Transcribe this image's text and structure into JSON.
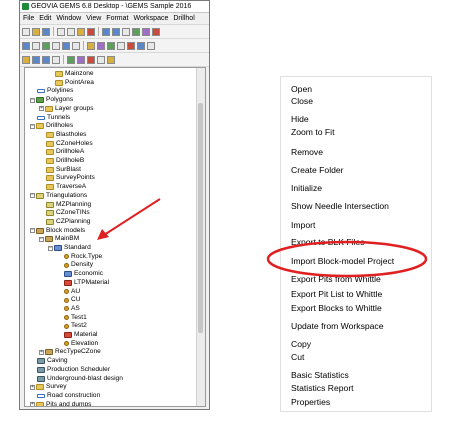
{
  "window": {
    "title": "GEOVIA GEMS 6.8 Desktop - \\GEMS Sample 2016"
  },
  "menubar": [
    "File",
    "Edit",
    "Window",
    "View",
    "Format",
    "Workspace",
    "Drillhol"
  ],
  "tree": [
    {
      "label": "Mainzone",
      "indent": 3,
      "icon": "folder",
      "expander": ""
    },
    {
      "label": "PointArea",
      "indent": 3,
      "icon": "folder",
      "expander": ""
    },
    {
      "label": "Polylines",
      "indent": 1,
      "icon": "line",
      "expander": ""
    },
    {
      "label": "Polygons",
      "indent": 1,
      "icon": "poly",
      "expander": "-"
    },
    {
      "label": "Layer groups",
      "indent": 2,
      "icon": "folder",
      "expander": "+"
    },
    {
      "label": "Tunnels",
      "indent": 1,
      "icon": "line",
      "expander": ""
    },
    {
      "label": "Drillholes",
      "indent": 1,
      "icon": "folder",
      "expander": "-"
    },
    {
      "label": "Blastholes",
      "indent": 2,
      "icon": "folder",
      "expander": ""
    },
    {
      "label": "CZoneHoles",
      "indent": 2,
      "icon": "folder",
      "expander": ""
    },
    {
      "label": "DrillholeA",
      "indent": 2,
      "icon": "folder",
      "expander": ""
    },
    {
      "label": "DrillholeB",
      "indent": 2,
      "icon": "folder",
      "expander": ""
    },
    {
      "label": "SurBlast",
      "indent": 2,
      "icon": "folder",
      "expander": ""
    },
    {
      "label": "SurveyPoints",
      "indent": 2,
      "icon": "folder",
      "expander": ""
    },
    {
      "label": "TraverseA",
      "indent": 2,
      "icon": "folder",
      "expander": ""
    },
    {
      "label": "Triangulations",
      "indent": 1,
      "icon": "tri",
      "expander": "-"
    },
    {
      "label": "MZPlanning",
      "indent": 2,
      "icon": "tri",
      "expander": ""
    },
    {
      "label": "CZoneTINs",
      "indent": 2,
      "icon": "tri",
      "expander": ""
    },
    {
      "label": "CZPlanning",
      "indent": 2,
      "icon": "tri",
      "expander": ""
    },
    {
      "label": "Block models",
      "indent": 1,
      "icon": "block",
      "expander": "-"
    },
    {
      "label": "MainBM",
      "indent": 2,
      "icon": "block",
      "expander": "-"
    },
    {
      "label": "Standard",
      "indent": 3,
      "icon": "cube",
      "expander": "-"
    },
    {
      "label": "Rock.Type",
      "indent": 4,
      "icon": "attr",
      "expander": ""
    },
    {
      "label": "Density",
      "indent": 4,
      "icon": "attr",
      "expander": ""
    },
    {
      "label": "Economic",
      "indent": 4,
      "icon": "cube",
      "expander": ""
    },
    {
      "label": "LTPMaterial",
      "indent": 4,
      "icon": "red",
      "expander": ""
    },
    {
      "label": "AU",
      "indent": 4,
      "icon": "attr",
      "expander": ""
    },
    {
      "label": "CU",
      "indent": 4,
      "icon": "attr",
      "expander": ""
    },
    {
      "label": "AS",
      "indent": 4,
      "icon": "attr",
      "expander": ""
    },
    {
      "label": "Test1",
      "indent": 4,
      "icon": "attr",
      "expander": ""
    },
    {
      "label": "Test2",
      "indent": 4,
      "icon": "attr",
      "expander": ""
    },
    {
      "label": "Material",
      "indent": 4,
      "icon": "red",
      "expander": ""
    },
    {
      "label": "Elevation",
      "indent": 4,
      "icon": "attr",
      "expander": ""
    },
    {
      "label": "RecTypeCZone",
      "indent": 2,
      "icon": "block",
      "expander": "+"
    },
    {
      "label": "Caving",
      "indent": 1,
      "icon": "mis",
      "expander": ""
    },
    {
      "label": "Production Scheduler",
      "indent": 1,
      "icon": "mis",
      "expander": ""
    },
    {
      "label": "Underground-blast design",
      "indent": 1,
      "icon": "mis",
      "expander": ""
    },
    {
      "label": "Survey",
      "indent": 1,
      "icon": "folder",
      "expander": "+"
    },
    {
      "label": "Road construction",
      "indent": 1,
      "icon": "line",
      "expander": ""
    },
    {
      "label": "Pits and dumps",
      "indent": 1,
      "icon": "folder",
      "expander": "+"
    }
  ],
  "context_menu": [
    "Open",
    "Close",
    "Hide",
    "Zoom to Fit",
    "Remove",
    "Create Folder",
    "Initialize",
    "Show Needle Intersection",
    "Import",
    "Export to BLK Files",
    "Import Block-model Project",
    "Export Pits from Whittle",
    "Export Pit List to Whittle",
    "Export Blocks to Whittle",
    "Update from Workspace",
    "Copy",
    "Cut",
    "Basic Statistics",
    "Statistics Report",
    "Properties"
  ],
  "highlight": {
    "color": "#e02020",
    "target": "Import Block-model Project",
    "arrow_target": "MainBM"
  }
}
